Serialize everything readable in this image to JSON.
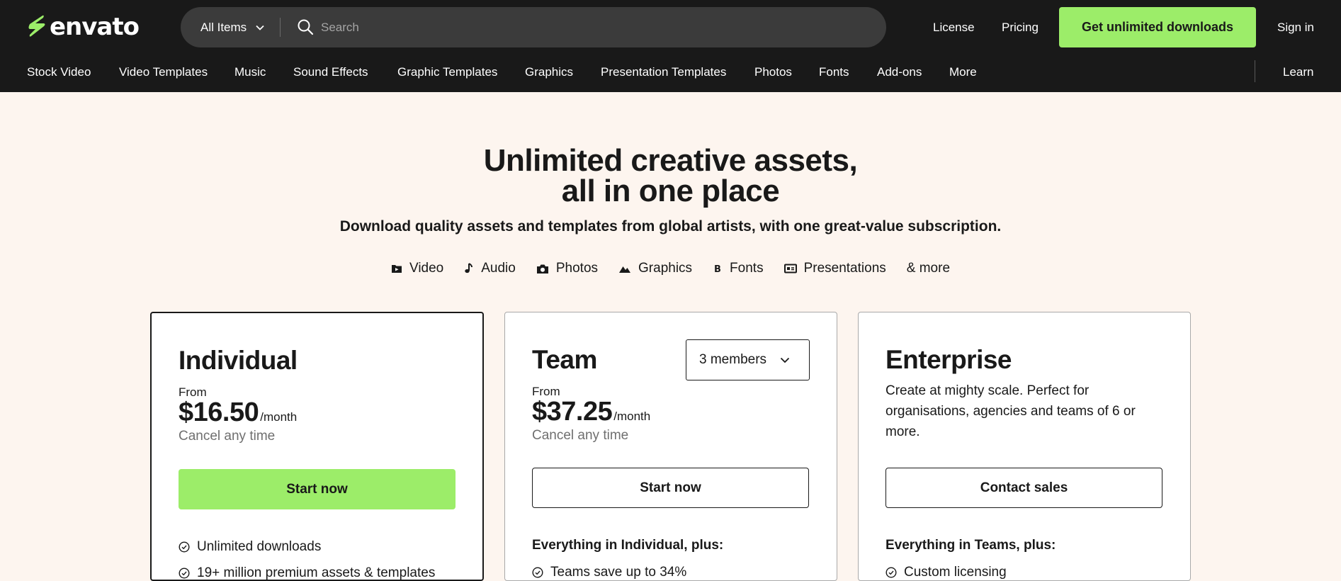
{
  "header": {
    "logo_text": "envato",
    "all_items_label": "All Items",
    "search_placeholder": "Search",
    "license_label": "License",
    "pricing_label": "Pricing",
    "cta_label": "Get unlimited downloads",
    "signin_label": "Sign in"
  },
  "nav": {
    "items": [
      "Stock Video",
      "Video Templates",
      "Music",
      "Sound Effects",
      "Graphic Templates",
      "Graphics",
      "Presentation Templates",
      "Photos",
      "Fonts",
      "Add-ons",
      "More"
    ],
    "learn_label": "Learn"
  },
  "hero": {
    "title_line1": "Unlimited creative assets,",
    "title_line2": "all in one place",
    "subtitle": "Download quality assets and templates from global artists, with one great-value subscription."
  },
  "asset_types": [
    {
      "label": "Video",
      "icon": "video-folder-icon"
    },
    {
      "label": "Audio",
      "icon": "music-note-icon"
    },
    {
      "label": "Photos",
      "icon": "camera-icon"
    },
    {
      "label": "Graphics",
      "icon": "mountain-icon"
    },
    {
      "label": "Fonts",
      "icon": "font-b-icon"
    },
    {
      "label": "Presentations",
      "icon": "presentation-icon"
    },
    {
      "label": "& more",
      "icon": ""
    }
  ],
  "plans": {
    "individual": {
      "title": "Individual",
      "from": "From",
      "price": "$16.50",
      "per": "/month",
      "cancel": "Cancel any time",
      "button": "Start now",
      "features": [
        "Unlimited downloads",
        "19+ million premium assets & templates"
      ]
    },
    "team": {
      "title": "Team",
      "members": "3 members",
      "from": "From",
      "price": "$37.25",
      "per": "/month",
      "cancel": "Cancel any time",
      "button": "Start now",
      "features_heading": "Everything in Individual, plus:",
      "features": [
        "Teams save up to 34%"
      ]
    },
    "enterprise": {
      "title": "Enterprise",
      "description": "Create at mighty scale. Perfect for organisations, agencies and teams of 6 or more.",
      "button": "Contact sales",
      "features_heading": "Everything in Teams, plus:",
      "features": [
        "Custom licensing"
      ]
    }
  },
  "colors": {
    "header_bg": "#191919",
    "page_bg": "#fdf5ef",
    "accent_green": "#9ced69",
    "search_bg": "#3b3b3b"
  }
}
